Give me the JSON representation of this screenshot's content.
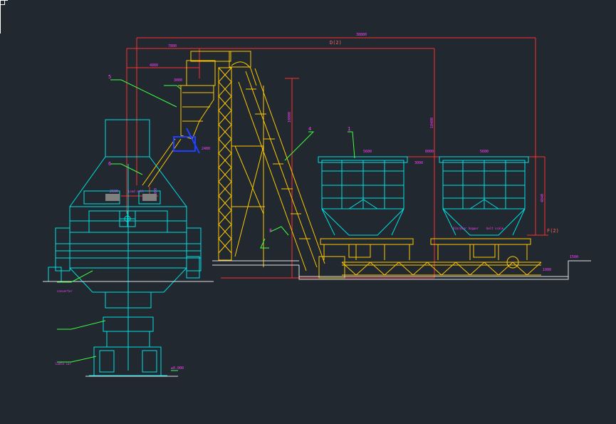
{
  "drawing": {
    "background": "#212830",
    "colors": {
      "equipment": "#00e0e0",
      "structure": "#ffc800",
      "dimension": "#ff3030",
      "leader": "#40ff40",
      "text": "#ff40ff",
      "ground": "#e0e0e0",
      "accent_blue": "#2040ff"
    },
    "dimensions": {
      "overall_length": "38880",
      "left_span": "7800",
      "inner_span": "4880",
      "top_label": "D(2)",
      "right_label": "F(2)",
      "vertical_right": "18480",
      "vertical_mid": "10800",
      "bin_spacing": "8000",
      "bin_width": "5600",
      "bin_height": "4840",
      "bin_top": "3000",
      "funnel_width": "2100",
      "funnel_height": "1980",
      "hopper_label": "3000",
      "elev_small": "2400",
      "level_a": "1500",
      "level_b": "1000"
    },
    "callouts": {
      "c1": "1",
      "c4": "4",
      "c5": "5",
      "c6": "6",
      "f_mark": "F"
    },
    "notes": {
      "bin_note_left": "Vibrator hopper",
      "bin_note_right": "belt scale",
      "load_note": "Load cell",
      "ground_left": "±0.000",
      "converter_note": "converter",
      "lower_note": "Ladle car"
    },
    "cursor_icon": "crosshair-cursor-icon"
  }
}
